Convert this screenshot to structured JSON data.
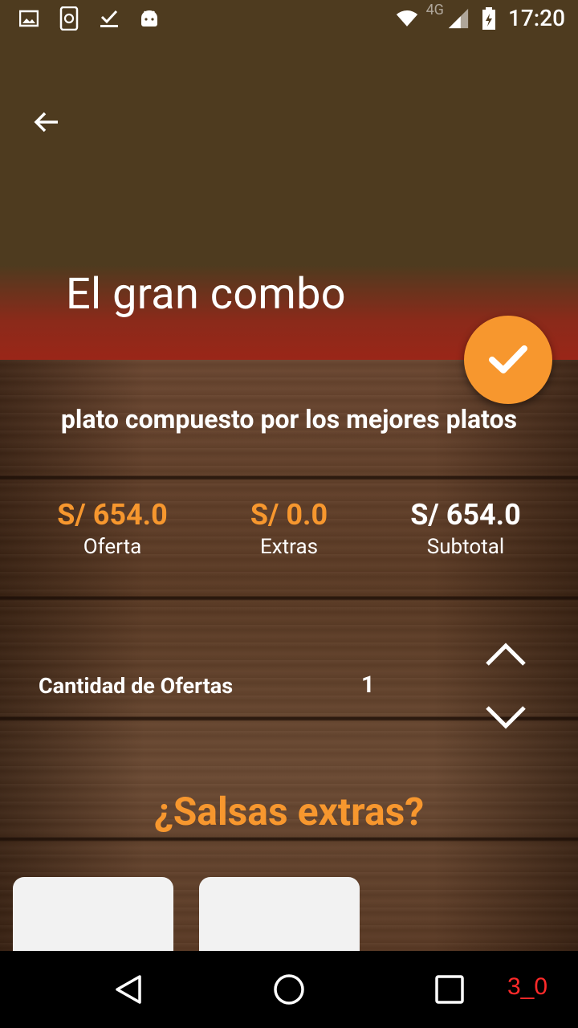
{
  "status_bar": {
    "time": "17:20",
    "network": "4G"
  },
  "header": {
    "title": "El gran combo"
  },
  "description": "plato compuesto por los mejores platos",
  "prices": {
    "offer": {
      "value": "S/ 654.0",
      "label": "Oferta"
    },
    "extras": {
      "value": "S/ 0.0",
      "label": "Extras"
    },
    "subtotal": {
      "value": "S/ 654.0",
      "label": "Subtotal"
    }
  },
  "quantity": {
    "label": "Cantidad de Ofertas",
    "value": "1"
  },
  "sauces": {
    "heading": "¿Salsas extras?"
  },
  "debug_code": "3_0",
  "colors": {
    "accent": "#f7972e",
    "header_top": "#4e3b1f",
    "header_bottom": "#9a2618"
  }
}
